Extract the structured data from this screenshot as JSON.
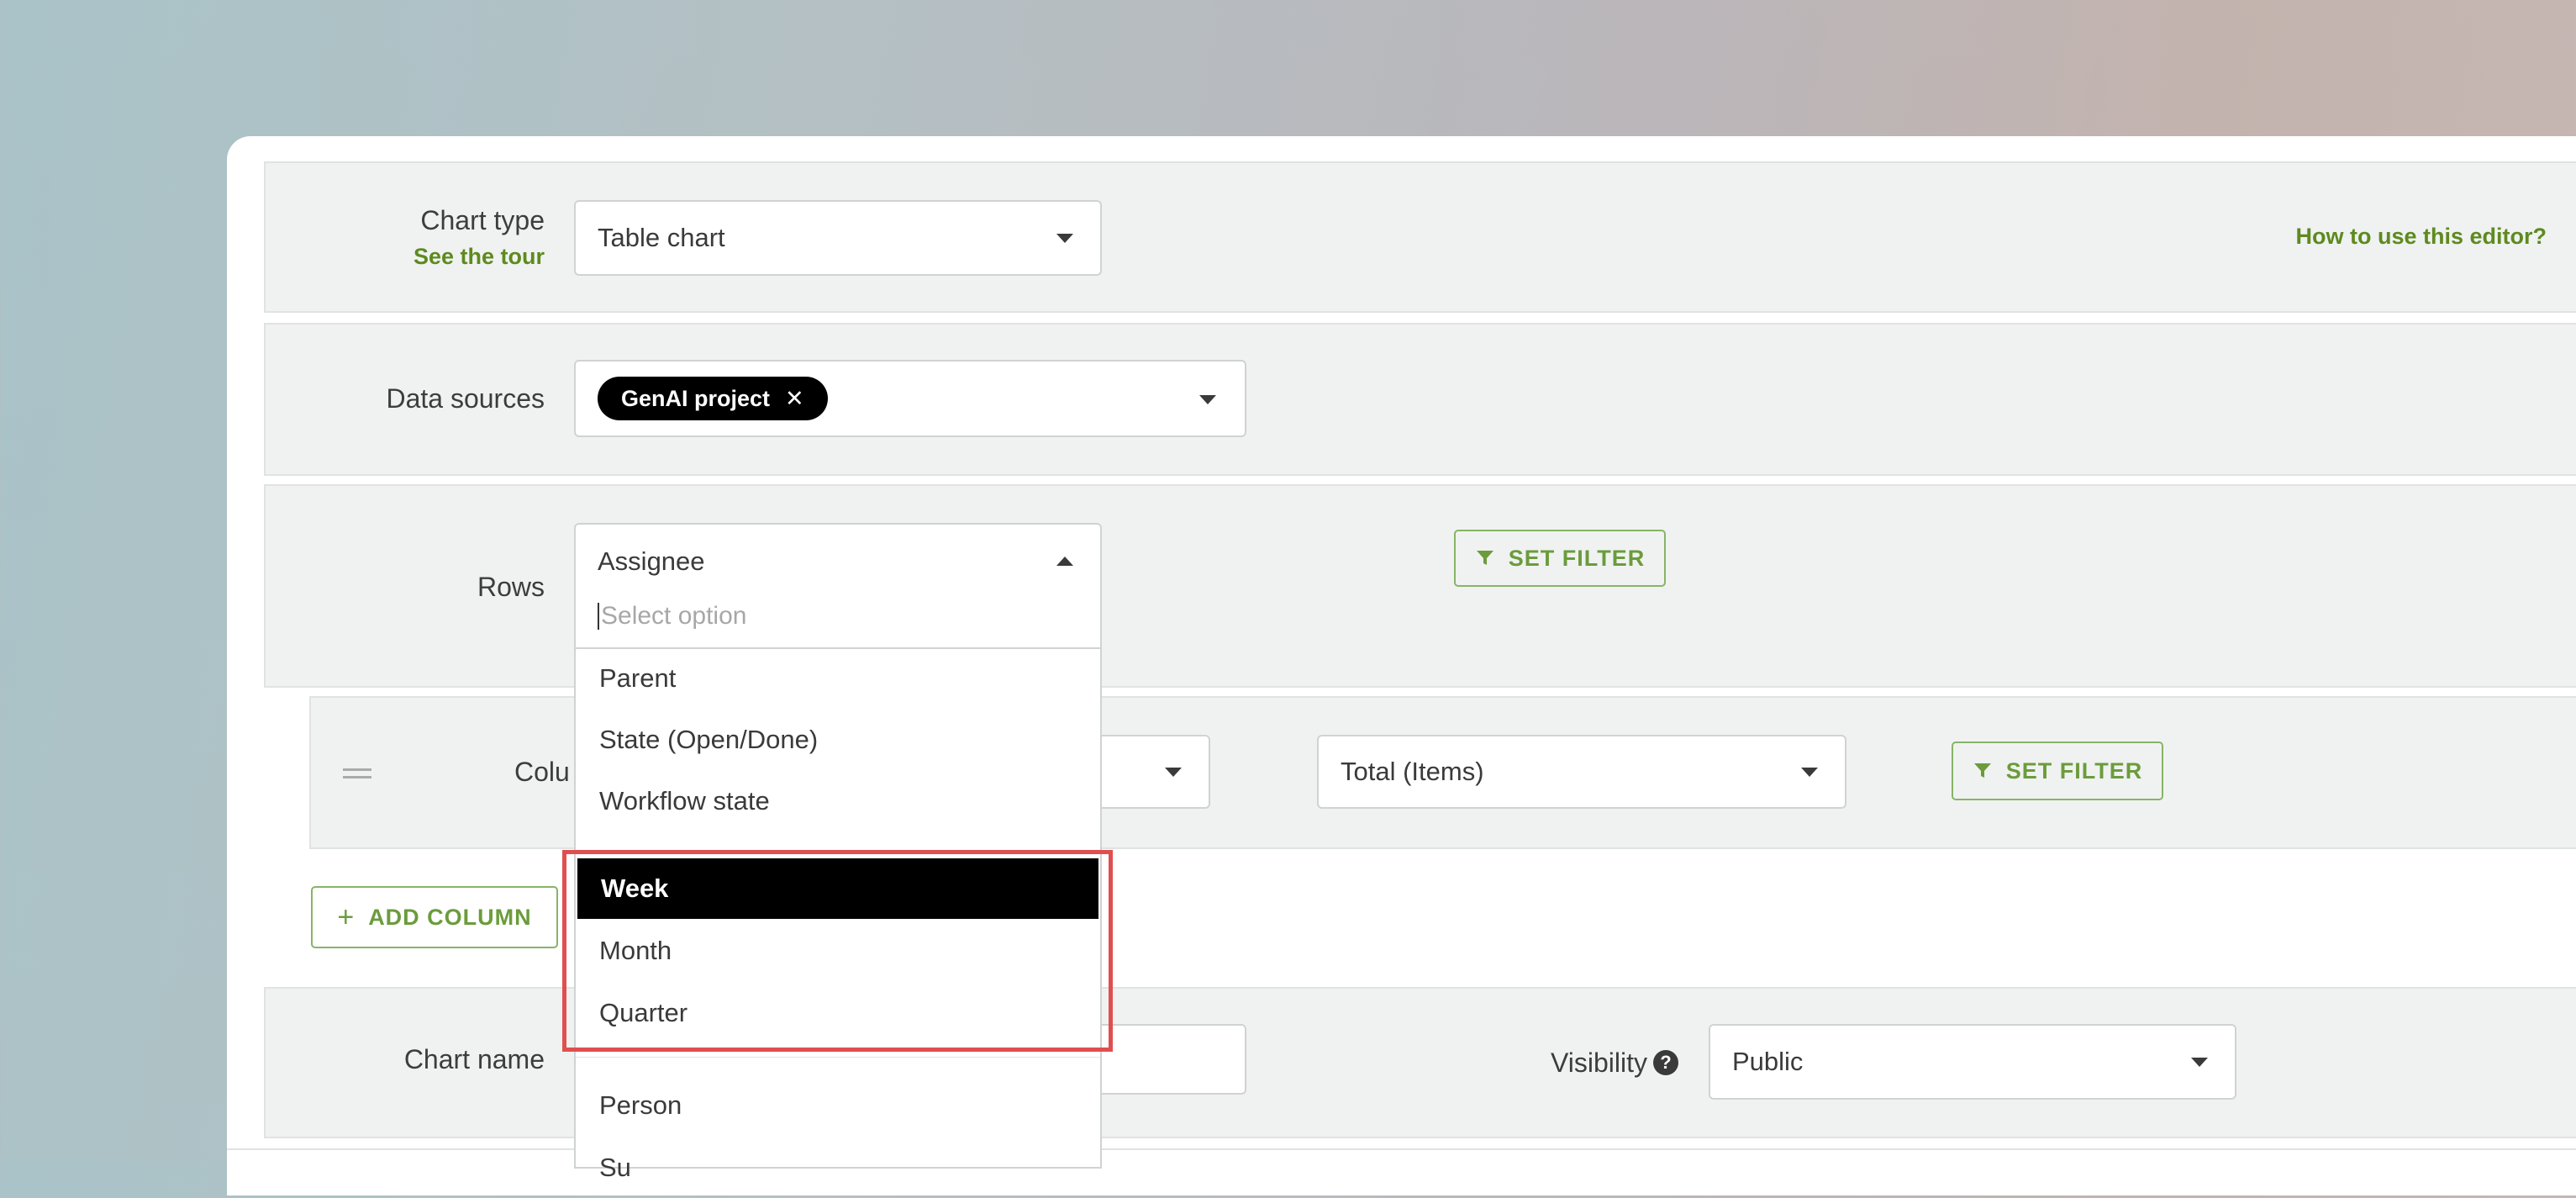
{
  "chart_type": {
    "label": "Chart type",
    "tour_link": "See the tour",
    "value": "Table chart",
    "help_link": "How to use this editor?"
  },
  "data_sources": {
    "label": "Data sources",
    "chip": "GenAI project",
    "chip_remove_icon": "✕"
  },
  "rows": {
    "label": "Rows",
    "value": "Assignee",
    "search_placeholder": "Select option",
    "filter_button": "SET FILTER"
  },
  "dropdown": {
    "options_before": [
      "Parent",
      "State (Open/Done)",
      "Workflow state"
    ],
    "highlighted_options": [
      "Week",
      "Month",
      "Quarter"
    ],
    "active_option": "Week",
    "options_after": [
      "Person",
      "Su"
    ]
  },
  "columns": {
    "label_partial": "Colu",
    "aggregate_value": "Total (Items)",
    "filter_button": "SET FILTER",
    "add_column_button": "ADD COLUMN",
    "add_icon": "+"
  },
  "chart_name": {
    "label": "Chart name",
    "value": ""
  },
  "visibility": {
    "label": "Visibility",
    "help_icon": "?",
    "value": "Public"
  },
  "colors": {
    "accent_green": "#6b9c3c",
    "highlight_red": "#e04f4f",
    "active_option_bg": "#000000"
  }
}
